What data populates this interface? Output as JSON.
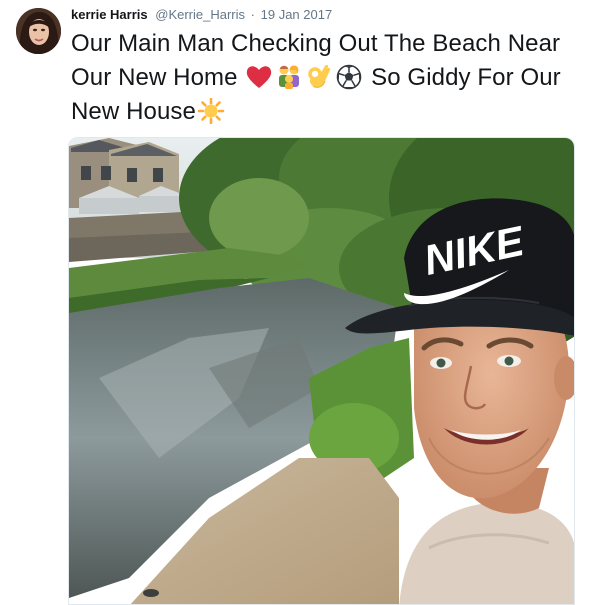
{
  "tweet": {
    "author_name": "kerrie Harris",
    "author_handle": "@Kerrie_Harris",
    "separator": "·",
    "timestamp": "19 Jan 2017",
    "text_part1": "Our Main Man Checking Out The Beach Near Our New Home ",
    "text_part2": " So Giddy For Our New House",
    "emojis": [
      "red-heart",
      "family",
      "ok-hand",
      "soccer-ball",
      "sun"
    ],
    "cap_logo_text": "NIKE"
  },
  "colors": {
    "name": "#14171a",
    "meta": "#657786",
    "text": "#14171a",
    "border": "#e1e8ed"
  }
}
